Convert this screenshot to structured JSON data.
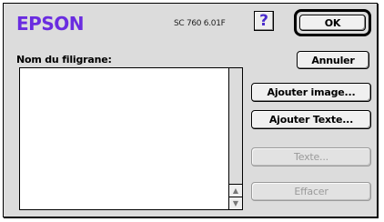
{
  "brand": {
    "text": "EPSON",
    "color": "#6a2ce0"
  },
  "version": "SC 760 6.01F",
  "help": {
    "glyph": "?",
    "color": "#4a2ccc"
  },
  "buttons": {
    "ok": "OK",
    "cancel": "Annuler",
    "add_image": "Ajouter image...",
    "add_text": "Ajouter Texte...",
    "text": "Texte...",
    "delete": "Effacer"
  },
  "field_label": "Nom du filigrane:",
  "watermark_list": [],
  "icons": {
    "scroll_up": "scroll-up-arrow-icon",
    "scroll_down": "scroll-down-arrow-icon",
    "help": "help-question-icon"
  }
}
